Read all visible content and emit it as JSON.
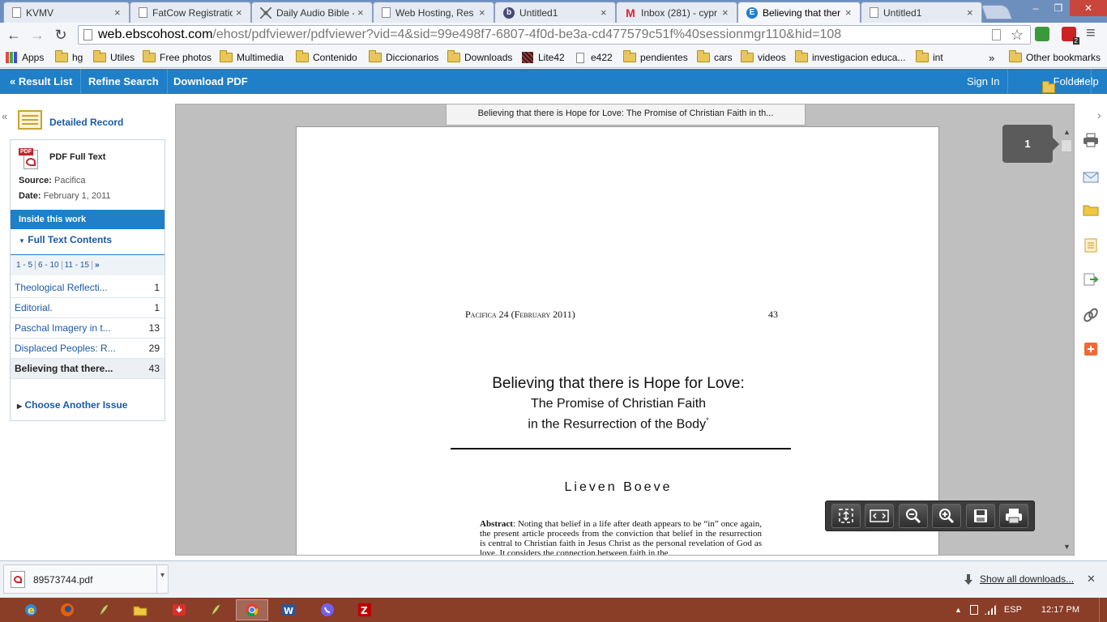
{
  "tabs": [
    {
      "label": "KVMV",
      "favicon": "page-icon"
    },
    {
      "label": "FatCow Registration",
      "favicon": "page-icon"
    },
    {
      "label": "Daily Audio Bible -",
      "favicon": "dab-icon"
    },
    {
      "label": "Web Hosting, Res",
      "favicon": "page-icon"
    },
    {
      "label": "Untitled1",
      "favicon": "b-icon"
    },
    {
      "label": "Inbox (281) - cypr",
      "favicon": "gmail-icon"
    },
    {
      "label": "Believing that ther",
      "favicon": "ebsco-icon"
    },
    {
      "label": "Untitled1",
      "favicon": "page-icon"
    }
  ],
  "tab_close": "×",
  "window_controls": {
    "minimize": "–",
    "maximize": "❐",
    "close": "✕"
  },
  "toolbar": {
    "back": "←",
    "forward": "→",
    "reload": "↻",
    "url_domain": "web.ebscohost.com",
    "url_path": "/ehost/pdfviewer/pdfviewer?vid=4&sid=99e498f7-6807-4f0d-be3a-cd477579c51f%40sessionmgr110&hid=108",
    "star": "☆",
    "menu": "≡",
    "ext_badge": "2"
  },
  "bookmarks": {
    "items": [
      "Apps",
      "hg",
      "Utiles",
      "Free photos",
      "Multimedia",
      "Contenido",
      "Diccionarios",
      "Downloads",
      "Lite42",
      "e422",
      "pendientes",
      "cars",
      "videos",
      "investigacion educa...",
      "int"
    ],
    "overflow": "»",
    "other": "Other bookmarks"
  },
  "ebsco_bar": {
    "result_list": "« Result List",
    "refine_search": "Refine Search",
    "download_pdf": "Download PDF",
    "sign_in": "Sign In",
    "folder": "Folder",
    "help": "Help"
  },
  "left_panel": {
    "collapse": "«",
    "detailed_record": "Detailed Record",
    "pdf_label": "PDF",
    "pdf_full_text": "PDF Full Text",
    "source_label": "Source:",
    "source_value": "Pacifica",
    "date_label": "Date:",
    "date_value": "February 1, 2011",
    "inside_this_work": "Inside this work",
    "full_text_contents": "Full Text Contents",
    "pagination": [
      "1 - 5",
      "6 - 10",
      "11 - 15",
      "»"
    ],
    "toc": [
      {
        "title": "Theological Reflecti...",
        "page": "1"
      },
      {
        "title": "Editorial.",
        "page": "1"
      },
      {
        "title": "Paschal Imagery in t...",
        "page": "13"
      },
      {
        "title": "Displaced Peoples: R...",
        "page": "29"
      },
      {
        "title": "Believing that there...",
        "page": "43"
      }
    ],
    "choose_another_issue": "Choose Another Issue"
  },
  "viewer": {
    "doc_title_bar": "Believing that there is Hope for Love: The Promise of Christian Faith in th...",
    "page_indicator": "1",
    "page": {
      "running_head": "Pacifica 24 (February 2011)",
      "page_number": "43",
      "title_line1": "Believing that there is Hope for Love:",
      "title_line2": "The Promise of Christian Faith",
      "title_line3": "in the Resurrection of the Body",
      "title_mark": "*",
      "author": "Lieven Boeve",
      "abstract_label": "Abstract",
      "abstract_text": ": Noting that belief in a life after death appears to be “in” once again, the present article proceeds from the conviction that belief in the resurrection is central to Christian faith in Jesus Christ as the personal revelation of God as love. It considers the connection between faith in the"
    },
    "zoom_tools": [
      "fit-page-icon",
      "fit-width-icon",
      "zoom-out-icon",
      "zoom-in-icon",
      "save-icon",
      "print-icon"
    ]
  },
  "right_tools": {
    "collapse": "›",
    "tools": [
      "print-icon",
      "email-icon",
      "folder-icon",
      "notes-icon",
      "export-icon",
      "permalink-icon",
      "share-icon"
    ]
  },
  "download_shelf": {
    "filename": "89573744.pdf",
    "show_all": "Show all downloads...",
    "close": "✕",
    "arrow": "▾"
  },
  "taskbar": {
    "apps": [
      "ie-icon",
      "firefox-icon",
      "feather-icon",
      "explorer-icon",
      "downloader-icon",
      "feather-icon",
      "chrome-icon",
      "word-icon",
      "viber-icon",
      "filezilla-icon"
    ],
    "language": "ESP",
    "time": "12:17 PM"
  },
  "colors": {
    "ebsco_blue": "#1f7fc8",
    "link_blue": "#1a5aa6",
    "tabstrip": "#6d8fbe",
    "taskbar": "#8a3d27"
  }
}
